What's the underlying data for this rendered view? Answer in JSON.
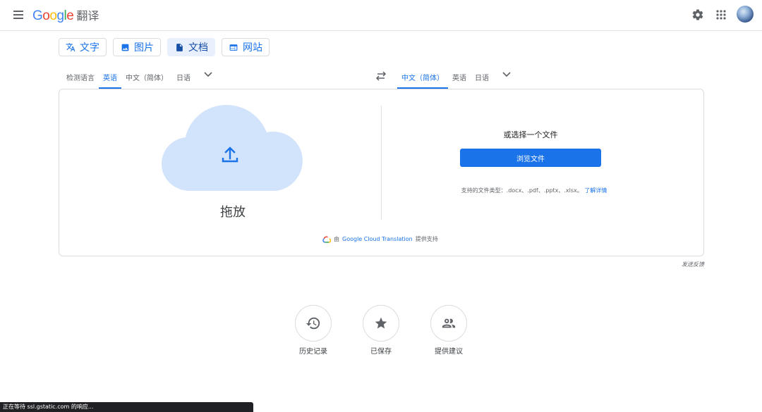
{
  "header": {
    "menu_icon": "hamburger-icon",
    "logo_letters": [
      "G",
      "o",
      "o",
      "g",
      "l",
      "e"
    ],
    "logo_suffix": "翻译",
    "settings_icon": "gear-icon",
    "apps_icon": "apps-grid-icon",
    "colors": {
      "blue": "#4285f4",
      "red": "#ea4335",
      "yellow": "#fbbc05",
      "green": "#34a853"
    }
  },
  "mode_tabs": [
    {
      "label": "文字",
      "icon": "translate-icon",
      "active": false
    },
    {
      "label": "图片",
      "icon": "image-icon",
      "active": false
    },
    {
      "label": "文档",
      "icon": "document-icon",
      "active": true
    },
    {
      "label": "网站",
      "icon": "website-icon",
      "active": false
    }
  ],
  "source_langs": [
    {
      "label": "检测语言",
      "selected": false
    },
    {
      "label": "英语",
      "selected": true
    },
    {
      "label": "中文（简体）",
      "selected": false
    },
    {
      "label": "日语",
      "selected": false
    }
  ],
  "target_langs": [
    {
      "label": "中文（简体）",
      "selected": true
    },
    {
      "label": "英语",
      "selected": false
    },
    {
      "label": "日语",
      "selected": false
    }
  ],
  "upload": {
    "drop_label": "拖放",
    "choose_label": "或选择一个文件",
    "browse_button": "浏览文件",
    "supported_prefix": "支持的文件类型：.docx、.pdf、.pptx、.xlsx。",
    "learn_more": "了解详情"
  },
  "powered_by": {
    "prefix": "由",
    "link": "Google Cloud Translation",
    "suffix": "提供支持"
  },
  "feedback": "发送反馈",
  "shortcuts": [
    {
      "label": "历史记录",
      "icon": "history-icon"
    },
    {
      "label": "已保存",
      "icon": "star-icon"
    },
    {
      "label": "提供建议",
      "icon": "people-icon"
    }
  ],
  "status_bar": "正在等待 ssl.gstatic.com 的响应...",
  "accent_color": "#1a73e8"
}
